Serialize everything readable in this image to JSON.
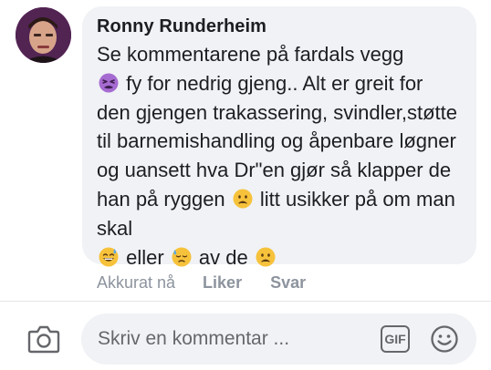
{
  "comment": {
    "author": "Ronny Runderheim",
    "segments": [
      {
        "type": "text",
        "value": "Se kommentarene på fardals vegg\n"
      },
      {
        "type": "emoji",
        "icon": "tired-face-emoji"
      },
      {
        "type": "text",
        "value": " fy for nedrig gjeng.. Alt er greit for den gjengen trakassering, svindler,støtte til barnemishandling og åpenbare løgner og uansett hva Dr\"en gjør så klapper de han på ryggen "
      },
      {
        "type": "emoji",
        "icon": "frowning-face-emoji"
      },
      {
        "type": "text",
        "value": " litt usikker på om man skal\n"
      },
      {
        "type": "emoji",
        "icon": "grinning-sweat-emoji"
      },
      {
        "type": "text",
        "value": " eller "
      },
      {
        "type": "emoji",
        "icon": "downcast-sweat-emoji"
      },
      {
        "type": "text",
        "value": " av de "
      },
      {
        "type": "emoji",
        "icon": "frowning-face-emoji"
      }
    ]
  },
  "actions": {
    "timestamp": "Akkurat nå",
    "like_label": "Liker",
    "reply_label": "Svar"
  },
  "composer": {
    "placeholder": "Skriv en kommentar ...",
    "gif_label": "GIF"
  },
  "colors": {
    "bubble_bg": "#f0f2f5",
    "text": "#1c1e21",
    "muted": "#8d949e"
  }
}
